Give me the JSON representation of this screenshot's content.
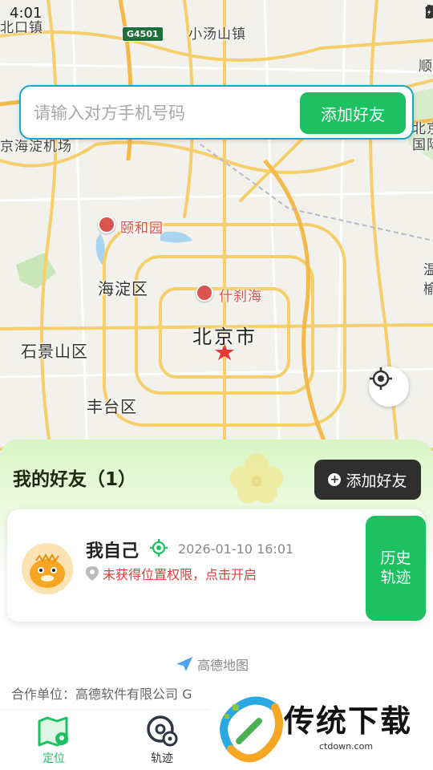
{
  "status_bar": {
    "time": "4:01"
  },
  "map": {
    "road_sign": "G4501",
    "labels": {
      "top_left": "北口镇",
      "xiaotangshan": "小汤山镇",
      "shun": "顺",
      "haidian_airport": "京海淀机场",
      "yiheyuan": "颐和园",
      "haidian": "海淀区",
      "shichahai": "什刹海",
      "beijing": "北京市",
      "shijingshan": "石景山区",
      "fengtai": "丰台区",
      "right_edge_1": "北京",
      "right_edge_2": "国际",
      "right_edge_3": "温",
      "right_edge_4": "榆"
    }
  },
  "search": {
    "placeholder": "请输入对方手机号码",
    "add_label": "添加好友"
  },
  "sheet": {
    "title": "我的好友（1）",
    "add_label": "添加好友",
    "friend": {
      "name": "我自己",
      "time": "2026-01-10 16:01",
      "status": "未获得位置权限，点击开启",
      "history_line1": "历史",
      "history_line2": "轨迹"
    },
    "amap_logo": "高德地图",
    "partner": "合作单位：高德软件有限公司 G"
  },
  "nav": {
    "items": [
      {
        "label": "定位",
        "icon": "map-marker-icon",
        "active": true
      },
      {
        "label": "轨迹",
        "icon": "track-pin-icon",
        "active": false
      }
    ]
  },
  "watermark": {
    "text": "传统下载",
    "url": "ctdown.com"
  },
  "colors": {
    "accent": "#1dc162",
    "search_border": "#18a8c9",
    "dark_button": "#2f2f2f",
    "warning": "#e23b3b"
  }
}
